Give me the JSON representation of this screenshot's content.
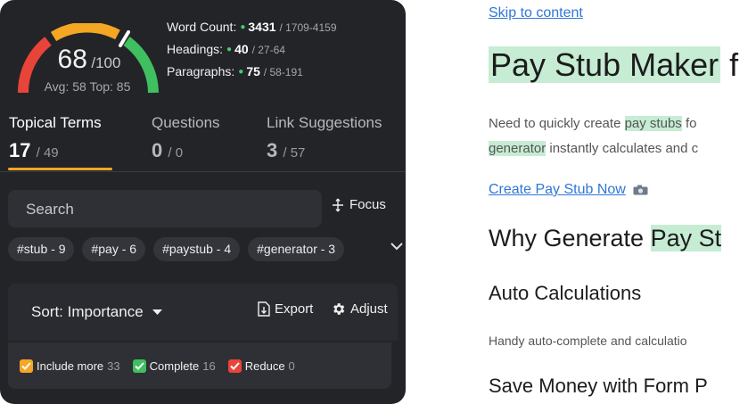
{
  "score": {
    "value": "68",
    "max": "/100",
    "avg_top": "Avg: 58 Top: 85"
  },
  "stats": [
    {
      "label": "Word Count:",
      "value": "3431",
      "range": "/ 1709-4159"
    },
    {
      "label": "Headings:",
      "value": "40",
      "range": "/ 27-64"
    },
    {
      "label": "Paragraphs:",
      "value": "75",
      "range": "/ 58-191"
    }
  ],
  "tabs": [
    {
      "label": "Topical Terms",
      "count": "17",
      "total": "/ 49"
    },
    {
      "label": "Questions",
      "count": "0",
      "total": "/ 0"
    },
    {
      "label": "Link Suggestions",
      "count": "3",
      "total": "/ 57"
    }
  ],
  "search": {
    "placeholder": "Search"
  },
  "focus_label": "Focus",
  "chips": [
    "#stub - 9",
    "#pay - 6",
    "#paystub - 4",
    "#generator - 3"
  ],
  "toolbar": {
    "sort_label": "Sort: Importance",
    "export_label": "Export",
    "adjust_label": "Adjust"
  },
  "filters": [
    {
      "label": "Include more",
      "count": "33",
      "color": "#f5a623"
    },
    {
      "label": "Complete",
      "count": "16",
      "color": "#3fbf5f"
    },
    {
      "label": "Reduce",
      "count": "0",
      "color": "#e8443a"
    }
  ],
  "doc": {
    "skip_link": "Skip to content",
    "title_hl": "Pay Stub Maker",
    "title_rest": " f",
    "p1_pre": "Need to quickly create ",
    "p1_hl": "pay stubs",
    "p1_post": " fo",
    "p2_hl": "generator",
    "p2_post": " instantly calculates and c",
    "cta": "Create Pay Stub Now",
    "h2_pre": "Why Generate ",
    "h2_hl": "Pay St",
    "h3a": "Auto Calculations",
    "p3": "Handy auto-complete and calculatio",
    "h3b": "Save Money with Form P"
  },
  "colors": {
    "accent": "#f5a623",
    "gauge_red": "#e8443a",
    "gauge_orange": "#f5a623",
    "gauge_green": "#3fbf5f",
    "highlight": "#c6ecd3",
    "link": "#2f77d8"
  },
  "gauge_fraction": 0.68
}
